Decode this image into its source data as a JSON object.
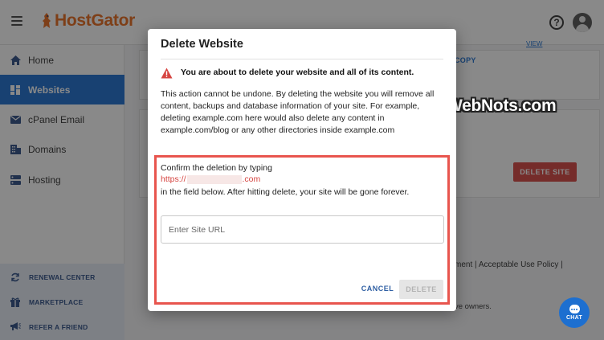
{
  "header": {
    "logo_text": "HostGator"
  },
  "sidebar": {
    "items": [
      {
        "label": "Home"
      },
      {
        "label": "Websites"
      },
      {
        "label": "cPanel Email"
      },
      {
        "label": "Domains"
      },
      {
        "label": "Hosting"
      }
    ],
    "bottom_items": [
      {
        "label": "RENEWAL CENTER"
      },
      {
        "label": "MARKETPLACE"
      },
      {
        "label": "REFER A FRIEND"
      }
    ]
  },
  "background": {
    "view_link": "VIEW",
    "copy_link": "COPY",
    "delete_site_button": "DELETE SITE",
    "footer_links": "ment  |  Acceptable Use Policy  |",
    "footer_owners": "ve owners."
  },
  "modal": {
    "title": "Delete Website",
    "warning": "You are about to delete your website and all of its content.",
    "body": "This action cannot be undone. By deleting the website you will remove all content, backups and database information of your site. For example, deleting example.com here would also delete any content in example.com/blog or any other directories inside example.com",
    "confirm_text": "Confirm the deletion by typing",
    "url_prefix": "https://",
    "url_suffix": ".com",
    "confirm_after": "in the field below. After hitting delete, your site will be gone forever.",
    "input_placeholder": "Enter Site URL",
    "cancel_label": "CANCEL",
    "delete_label": "DELETE"
  },
  "watermark": "WebNots.com",
  "chat_label": "CHAT",
  "colors": {
    "brand_orange": "#e86a1c",
    "primary_blue": "#1d6fd0",
    "danger_red": "#d64541",
    "highlight_box": "#e8554e"
  }
}
